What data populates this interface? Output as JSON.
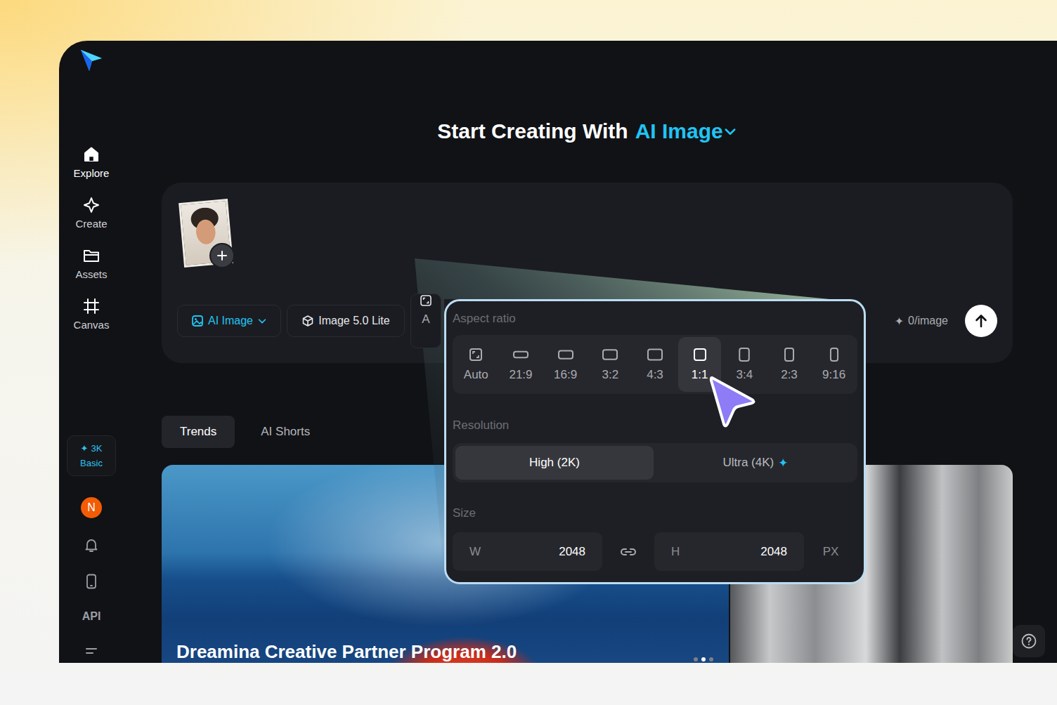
{
  "sidebar": {
    "items": [
      {
        "label": "Explore",
        "selected": true
      },
      {
        "label": "Create",
        "selected": false
      },
      {
        "label": "Assets",
        "selected": false
      },
      {
        "label": "Canvas",
        "selected": false
      }
    ],
    "credits": {
      "icon": "✦",
      "amount": "3K",
      "plan": "Basic"
    },
    "avatar": "N",
    "api": "API"
  },
  "header": {
    "prefix": "Start Creating With",
    "mode": "AI Image"
  },
  "prompt": {
    "toolbar": [
      {
        "label": "AI Image",
        "kind": "mode"
      },
      {
        "label": "Image 5.0 Lite",
        "kind": "model"
      },
      {
        "label": "A",
        "kind": "ratio"
      }
    ],
    "cost": {
      "icon": "✦",
      "label": "0/image"
    }
  },
  "tabs": [
    {
      "label": "Trends",
      "selected": true
    },
    {
      "label": "AI Shorts",
      "selected": false
    }
  ],
  "banner": {
    "title": "Dreamina Creative Partner Program 2.0",
    "dots": [
      {
        "selected": false
      },
      {
        "selected": true
      },
      {
        "selected": false
      }
    ]
  },
  "popup": {
    "aspect_label": "Aspect ratio",
    "ratios": [
      {
        "label": "Auto",
        "kind": "auto",
        "selected": false
      },
      {
        "label": "21:9",
        "kind": "ratio",
        "selected": false
      },
      {
        "label": "16:9",
        "kind": "ratio",
        "selected": false
      },
      {
        "label": "3:2",
        "kind": "ratio",
        "selected": false
      },
      {
        "label": "4:3",
        "kind": "ratio",
        "selected": false
      },
      {
        "label": "1:1",
        "kind": "ratio",
        "selected": true
      },
      {
        "label": "3:4",
        "kind": "ratio",
        "selected": false
      },
      {
        "label": "2:3",
        "kind": "ratio",
        "selected": false
      },
      {
        "label": "9:16",
        "kind": "ratio",
        "selected": false
      }
    ],
    "resolution_label": "Resolution",
    "resolutions": [
      {
        "label": "High (2K)",
        "selected": true,
        "icon": ""
      },
      {
        "label": "Ultra (4K)",
        "selected": false,
        "icon": "✦"
      }
    ],
    "size_label": "Size",
    "width": {
      "label": "W",
      "value": "2048"
    },
    "height": {
      "label": "H",
      "value": "2048"
    },
    "unit": "PX"
  }
}
